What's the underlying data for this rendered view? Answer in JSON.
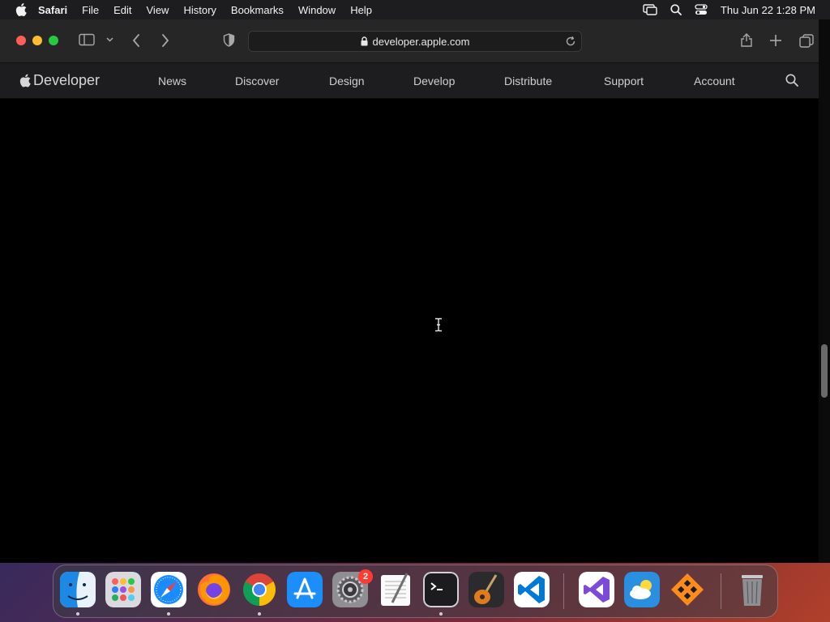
{
  "menubar": {
    "items": [
      "Safari",
      "File",
      "Edit",
      "View",
      "History",
      "Bookmarks",
      "Window",
      "Help"
    ],
    "clock": "Thu Jun 22  1:28 PM"
  },
  "browser": {
    "url": "developer.apple.com"
  },
  "site": {
    "brand": "Developer",
    "nav": [
      "News",
      "Discover",
      "Design",
      "Develop",
      "Distribute",
      "Support",
      "Account"
    ]
  },
  "dock": {
    "apps": [
      "Finder",
      "Launchpad",
      "Safari",
      "Firefox",
      "Chrome",
      "App Store",
      "System Settings",
      "TextEdit",
      "Terminal",
      "GarageBand",
      "Visual Studio Code",
      "Visual Studio",
      "Weather",
      "Tunnelblick",
      "Trash"
    ],
    "settings_badge": "2"
  }
}
